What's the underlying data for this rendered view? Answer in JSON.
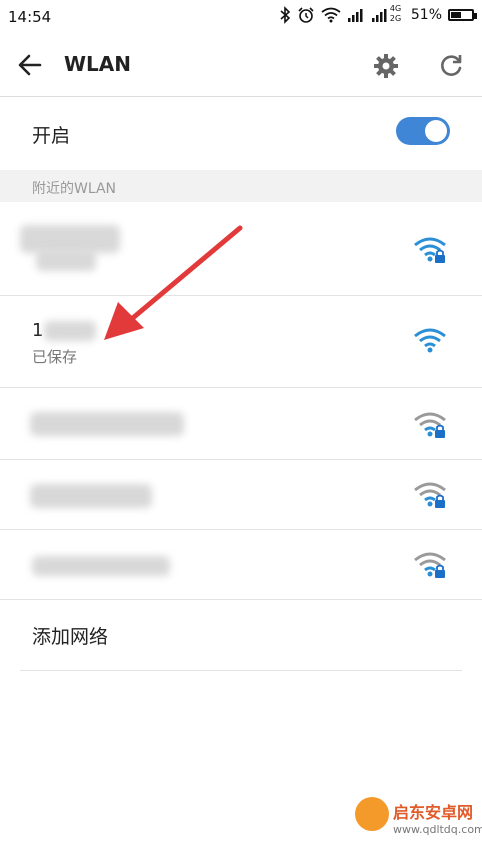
{
  "status_bar": {
    "time": "14:54",
    "network_type": "4G",
    "network_sub": "2G",
    "battery_text": "51%",
    "battery_level": 0.51,
    "icons": [
      "bluetooth-icon",
      "alarm-icon",
      "wifi-status-icon",
      "signal-icon",
      "signal-4g-icon",
      "battery-icon"
    ]
  },
  "app_bar": {
    "title": "WLAN",
    "icons": [
      "back-arrow-icon",
      "settings-gear-icon",
      "refresh-icon"
    ]
  },
  "toggle": {
    "label": "开启",
    "state": "on",
    "accent": "#3f86d6"
  },
  "section": {
    "title": "附近的WLAN"
  },
  "networks": [
    {
      "name": "",
      "sub": "",
      "secured": true,
      "connected": true
    },
    {
      "name": "1",
      "sub": "已保存",
      "secured": false,
      "connected": true
    },
    {
      "name": "",
      "sub": "",
      "secured": true,
      "connected": false
    },
    {
      "name": "",
      "sub": "",
      "secured": true,
      "connected": false
    },
    {
      "name": "",
      "sub": "",
      "secured": true,
      "connected": false
    }
  ],
  "add_network": {
    "label": "添加网络"
  },
  "watermark": {
    "text": "启东安卓网",
    "url": "www.qdltdq.com"
  },
  "colors": {
    "wifi_active": "#2a8fd6",
    "wifi_inactive": "#9a9a9a",
    "lock": "#1c6fc7",
    "annotation_arrow": "#e23a3a"
  }
}
